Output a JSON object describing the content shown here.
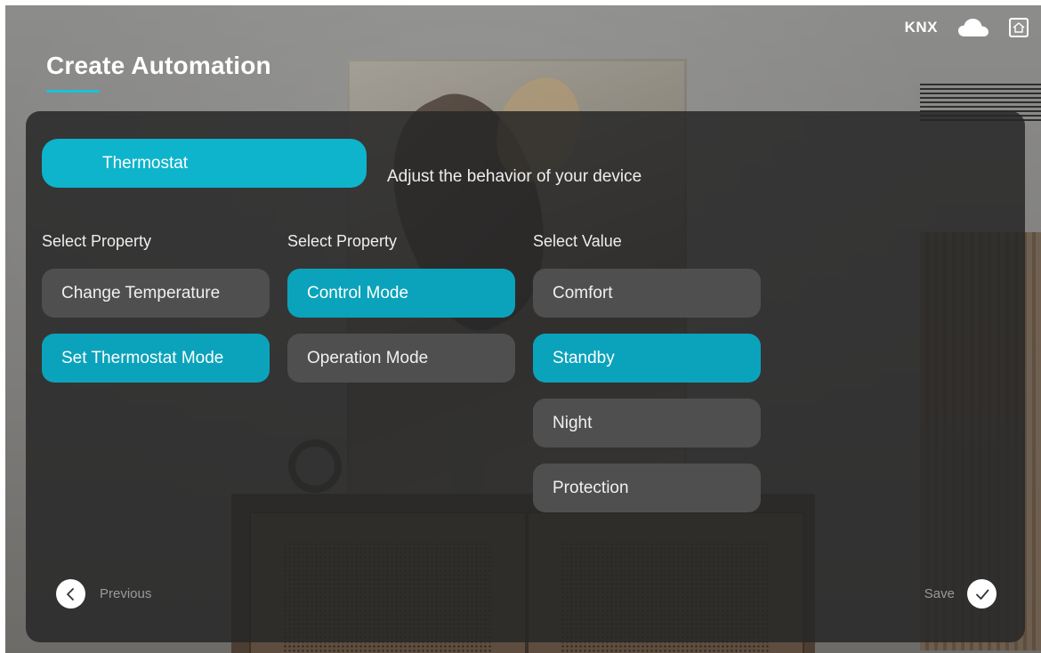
{
  "header": {
    "title": "Create Automation",
    "status_label": "KNX",
    "cloud_icon": "cloud-icon",
    "gateway_icon": "home-gateway-icon"
  },
  "device": {
    "name": "Thermostat",
    "description": "Adjust the behavior of your device"
  },
  "columns": [
    {
      "label": "Select Property",
      "options": [
        {
          "label": "Change Temperature",
          "selected": false
        },
        {
          "label": "Set Thermostat Mode",
          "selected": true
        }
      ]
    },
    {
      "label": "Select Property",
      "options": [
        {
          "label": "Control Mode",
          "selected": true
        },
        {
          "label": "Operation Mode",
          "selected": false
        }
      ]
    },
    {
      "label": "Select Value",
      "options": [
        {
          "label": "Comfort",
          "selected": false
        },
        {
          "label": "Standby",
          "selected": true
        },
        {
          "label": "Night",
          "selected": false
        },
        {
          "label": "Protection",
          "selected": false
        }
      ]
    }
  ],
  "footer": {
    "previous_label": "Previous",
    "save_label": "Save"
  },
  "colors": {
    "accent": "#0db4cc",
    "selected": "#0aa3bb",
    "option_bg": "#4f4f4f",
    "panel_bg": "#282828"
  }
}
